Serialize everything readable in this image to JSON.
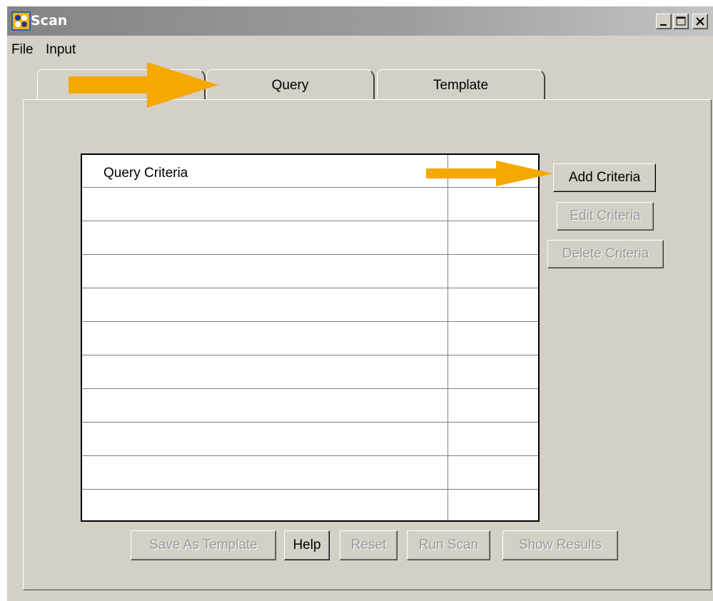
{
  "window": {
    "title": "Scan",
    "controls": {
      "minimize": "minimize-icon",
      "maximize": "maximize-icon",
      "close": "close-icon"
    }
  },
  "menubar": {
    "items": [
      "File",
      "Input"
    ]
  },
  "tabs": [
    {
      "label": ""
    },
    {
      "label": "Query"
    },
    {
      "label": "Template"
    }
  ],
  "criteria_table": {
    "header": "Query Criteria",
    "row_count": 10
  },
  "side_buttons": {
    "add": "Add Criteria",
    "edit": "Edit Criteria",
    "delete": "Delete Criteria"
  },
  "bottom_buttons": {
    "save_template": "Save As Template",
    "help": "Help",
    "reset": "Reset",
    "run_scan": "Run Scan",
    "show_results": "Show Results"
  },
  "colors": {
    "face": "#d4d0c8",
    "arrow": "#f5a800",
    "disabled_text": "#9a9a9a"
  }
}
